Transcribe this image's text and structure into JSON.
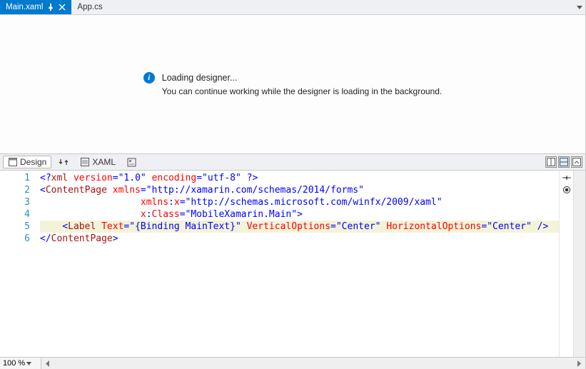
{
  "tabs": {
    "active": {
      "label": "Main.xaml"
    },
    "others": [
      {
        "label": "App.cs"
      }
    ]
  },
  "designer": {
    "title": "Loading designer...",
    "subtitle": "You can continue working while the designer is loading in the background."
  },
  "splitbar": {
    "design": "Design",
    "xaml": "XAML"
  },
  "code": {
    "lines": [
      {
        "n": "1"
      },
      {
        "n": "2"
      },
      {
        "n": "3"
      },
      {
        "n": "4"
      },
      {
        "n": "5"
      },
      {
        "n": "6"
      }
    ],
    "l1": {
      "open": "<?",
      "pi": "xml",
      "sp1": " ",
      "a1": "version",
      "eq": "=",
      "v1": "\"1.0\"",
      "sp2": " ",
      "a2": "encoding",
      "v2": "\"utf-8\"",
      "close": " ?>"
    },
    "l2": {
      "lt": "<",
      "el": "ContentPage",
      "sp": " ",
      "a": "xmlns",
      "eq": "=",
      "v": "\"http://xamarin.com/schemas/2014/forms\""
    },
    "l3": {
      "pad": "                  ",
      "a": "xmlns",
      "colon": ":",
      "px": "x",
      "eq": "=",
      "v": "\"http://schemas.microsoft.com/winfx/2009/xaml\""
    },
    "l4": {
      "pad": "                  ",
      "px": "x",
      "colon": ":",
      "a": "Class",
      "eq": "=",
      "v": "\"MobileXamarin.Main\"",
      "gt": ">"
    },
    "l5": {
      "pad": "    ",
      "lt": "<",
      "el": "Label",
      "sp": " ",
      "a1": "Text",
      "eq": "=",
      "v1": "\"{Binding MainText}\"",
      "sp2": " ",
      "a2": "VerticalOptions",
      "v2": "\"Center\"",
      "sp3": " ",
      "a3": "HorizontalOptions",
      "v3": "\"Center\"",
      "close": " />"
    },
    "l6": {
      "lt": "</",
      "el": "ContentPage",
      "gt": ">"
    }
  },
  "zoom": {
    "value": "100 %"
  }
}
